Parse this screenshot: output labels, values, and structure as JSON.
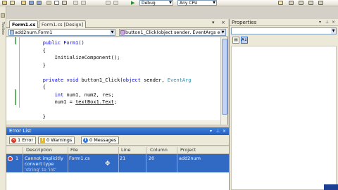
{
  "toolbar": {
    "config_value": "Debug",
    "platform_value": "Any CPU"
  },
  "leftrail": {
    "toolbox_label": "Toolbox"
  },
  "tabs": [
    {
      "label": "Form1.cs"
    },
    {
      "label": "Form1.cs [Design]"
    }
  ],
  "nav": {
    "class_combo": "add2num.Form1",
    "member_combo": "button1_Click(object sender, EventArgs e)"
  },
  "code": {
    "l1": "public Form1()",
    "l2": "{",
    "l3": "InitializeComponent();",
    "l4": "}",
    "l5_kw1": "private",
    "l5_kw2": "void",
    "l5_name": "button1_Click(",
    "l5_kw3": "object",
    "l5_mid": "sender,",
    "l5_ty": "EventArg",
    "l6": "{",
    "l7_kw": "int",
    "l7_rest": "num1, num2, res;",
    "l8_a": "num1 =",
    "l8_b": "textBox1.Text",
    "l8_c": ";",
    "l9": "}",
    "l10": "}"
  },
  "error_list": {
    "title": "Error List",
    "filters": {
      "errors": "1 Error",
      "warnings": "0 Warnings",
      "messages": "0 Messages"
    },
    "columns": [
      "Description",
      "File",
      "Line",
      "Column",
      "Project"
    ],
    "rows": [
      {
        "num": "1",
        "description": "Cannot implicitly convert type",
        "description_more": "'string' to 'int'",
        "file": "Form1.cs",
        "line": "21",
        "column": "20",
        "project": "add2num"
      }
    ]
  },
  "properties": {
    "title": "Properties"
  },
  "colors": {
    "keyword": "#0000ff",
    "type": "#2b91af",
    "selection": "#316ac5",
    "titlebar": "#235fc2"
  }
}
